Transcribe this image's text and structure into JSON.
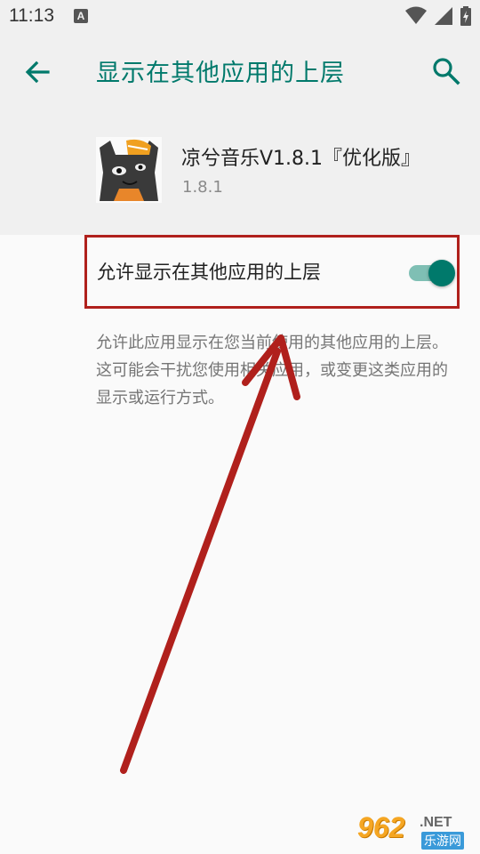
{
  "status_bar": {
    "time": "11:13",
    "notification_icon": "a-icon",
    "icons": [
      "wifi-icon",
      "signal-icon",
      "battery-icon"
    ]
  },
  "app_bar": {
    "title": "显示在其他应用的上层",
    "back_icon": "back-arrow-icon",
    "search_icon": "search-icon"
  },
  "app_info": {
    "name": "凉兮音乐V1.8.1『优化版』",
    "version": "1.8.1",
    "icon": "app-cat-icon"
  },
  "preference": {
    "label": "允许显示在其他应用的上层",
    "enabled": true,
    "summary": "允许此应用显示在您当前使用的其他应用的上层。这可能会干扰您使用相关应用，或变更这类应用的显示或运行方式。"
  },
  "watermark": {
    "number": "962",
    "suffix": ".NET",
    "site": "乐游网"
  },
  "colors": {
    "accent": "#00796b",
    "annotation": "#b0201c",
    "toggle_track": "#7fbfb4"
  }
}
